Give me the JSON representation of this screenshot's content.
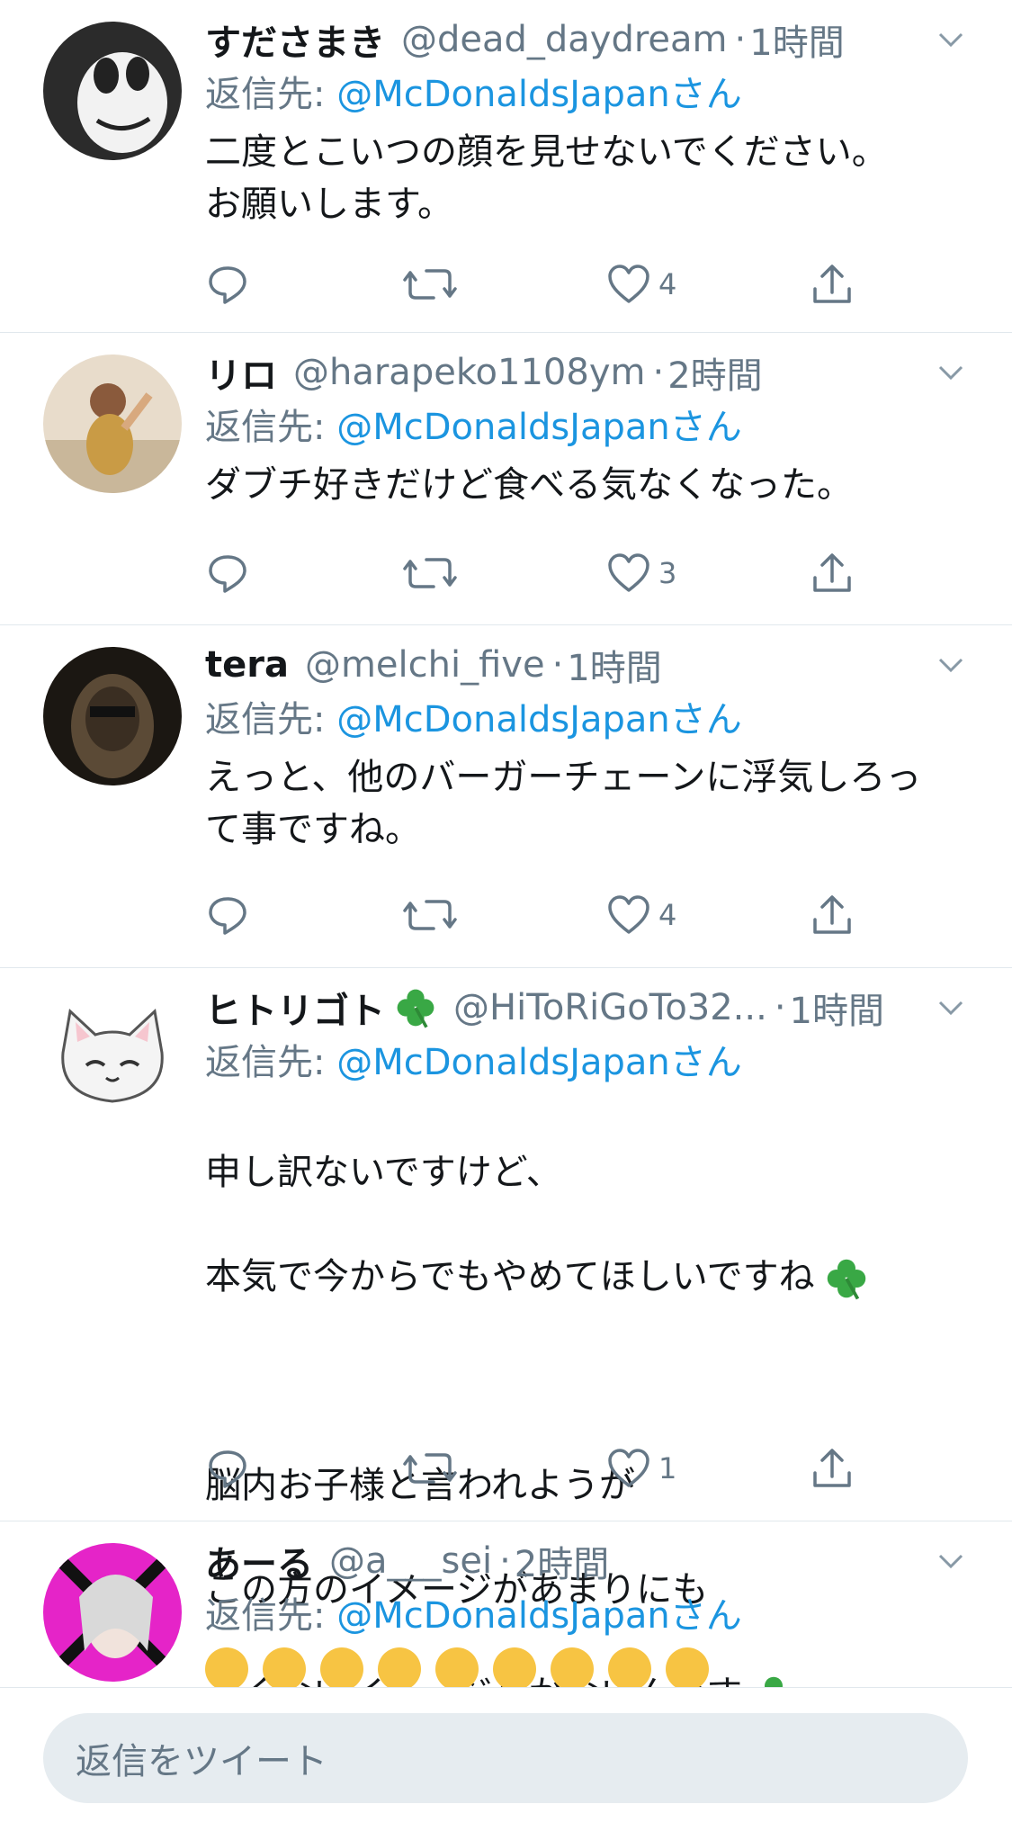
{
  "tweets": [
    {
      "name": "すださまき",
      "handle": "@dead_daydream",
      "time": "1時間",
      "reply_label": "返信先:",
      "reply_to": "@McDonaldsJapanさん",
      "text": "二度とこいつの顔を見せないでください。\nお願いします。",
      "likes": "4"
    },
    {
      "name": "リロ",
      "handle": "@harapeko1108ym",
      "time": "2時間",
      "reply_label": "返信先:",
      "reply_to": "@McDonaldsJapanさん",
      "text": "ダブチ好きだけど食べる気なくなった。",
      "likes": "3"
    },
    {
      "name": "tera",
      "handle": "@melchi_five",
      "time": "1時間",
      "reply_label": "返信先:",
      "reply_to": "@McDonaldsJapanさん",
      "text": "えっと、他のバーガーチェーンに浮気しろっ\nて事ですね。",
      "likes": "4"
    },
    {
      "name": "ヒトリゴト",
      "handle": "@HiToRiGoTo32...",
      "time": "1時間",
      "reply_label": "返信先:",
      "reply_to": "@McDonaldsJapanさん",
      "text_line1": "申し訳ないですけど、",
      "text_line2": "本気で今からでもやめてほしいですね",
      "text_line3": "脳内お子様と言われようが",
      "text_line4": "この方のイメージがあまりにも",
      "text_line5": "よくないイメージしかないんです",
      "likes": "1"
    },
    {
      "name": "あーる",
      "handle": "@a___sei",
      "time": "2時間",
      "reply_label": "返信先:",
      "reply_to": "@McDonaldsJapanさん",
      "emoji_count": 9
    }
  ],
  "separator": "·",
  "compose": {
    "placeholder": "返信をツイート"
  },
  "icons": [
    "chevron-down-icon",
    "reply-icon",
    "retweet-icon",
    "like-icon",
    "share-icon",
    "clover-icon"
  ],
  "colors": {
    "link": "#1b95e0",
    "secondary": "#657786",
    "divider": "#e1e8ed",
    "compose_bg": "#e6ecf0"
  }
}
